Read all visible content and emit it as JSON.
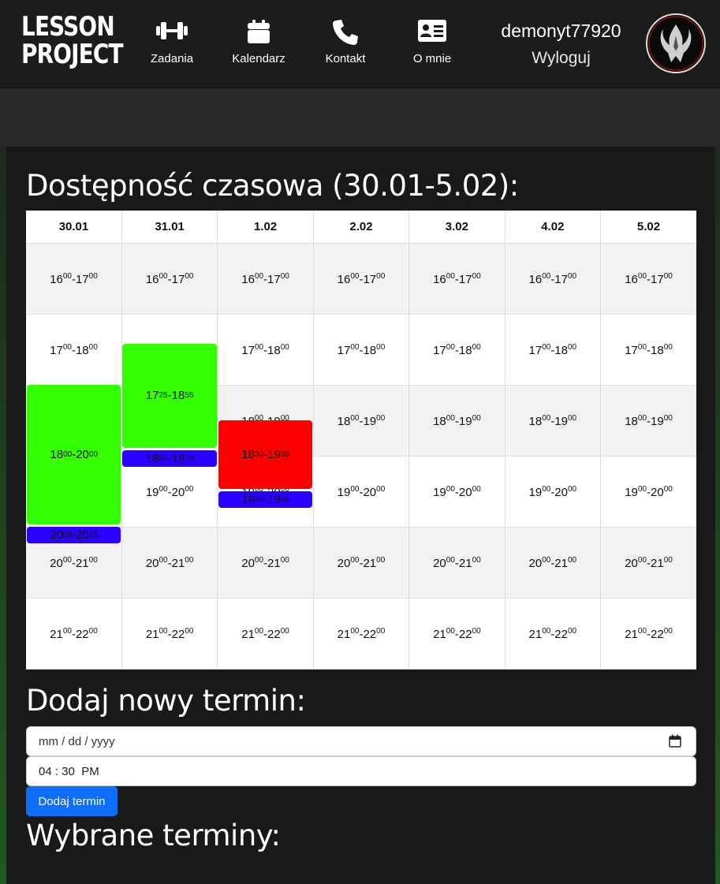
{
  "brand": {
    "line1": "LESSON",
    "line2": "PROJECT"
  },
  "nav": [
    {
      "label": "Zadania",
      "icon": "dumbbell-icon"
    },
    {
      "label": "Kalendarz",
      "icon": "calendar-icon"
    },
    {
      "label": "Kontakt",
      "icon": "phone-icon"
    },
    {
      "label": "O mnie",
      "icon": "id-card-icon"
    }
  ],
  "user": {
    "name": "demonyt77920",
    "logout": "Wyloguj"
  },
  "availability": {
    "title": "Dostępność czasowa (30.01-5.02):",
    "days": [
      "30.01",
      "31.01",
      "1.02",
      "2.02",
      "3.02",
      "4.02",
      "5.02"
    ],
    "slots": [
      {
        "start": "16",
        "end": "17"
      },
      {
        "start": "17",
        "end": "18"
      },
      {
        "start": "18",
        "end": "19"
      },
      {
        "start": "19",
        "end": "20"
      },
      {
        "start": "20",
        "end": "21"
      },
      {
        "start": "21",
        "end": "22"
      }
    ],
    "bookings": [
      {
        "day": "30.01",
        "start_h": "18",
        "start_m": "00",
        "end_h": "20",
        "end_m": "00",
        "color": "#33ff00"
      },
      {
        "day": "30.01",
        "start_h": "20",
        "start_m": "00",
        "end_h": "20",
        "end_m": "15",
        "color": "#2a00ff"
      },
      {
        "day": "31.01",
        "start_h": "17",
        "start_m": "25",
        "end_h": "18",
        "end_m": "55",
        "color": "#33ff00"
      },
      {
        "day": "31.01",
        "start_h": "18",
        "start_m": "55",
        "end_h": "19",
        "end_m": "10",
        "color": "#2a00ff"
      },
      {
        "day": "1.02",
        "start_h": "18",
        "start_m": "30",
        "end_h": "19",
        "end_m": "30",
        "color": "#ff0000"
      },
      {
        "day": "1.02",
        "start_h": "19",
        "start_m": "30",
        "end_h": "19",
        "end_m": "45",
        "color": "#2a00ff"
      }
    ]
  },
  "add_form": {
    "title": "Dodaj nowy termin:",
    "date_placeholder": "mm / dd / yyyy",
    "time_value": "04 : 30  PM",
    "submit": "Dodaj termin"
  },
  "selected": {
    "title": "Wybrane terminy:"
  }
}
